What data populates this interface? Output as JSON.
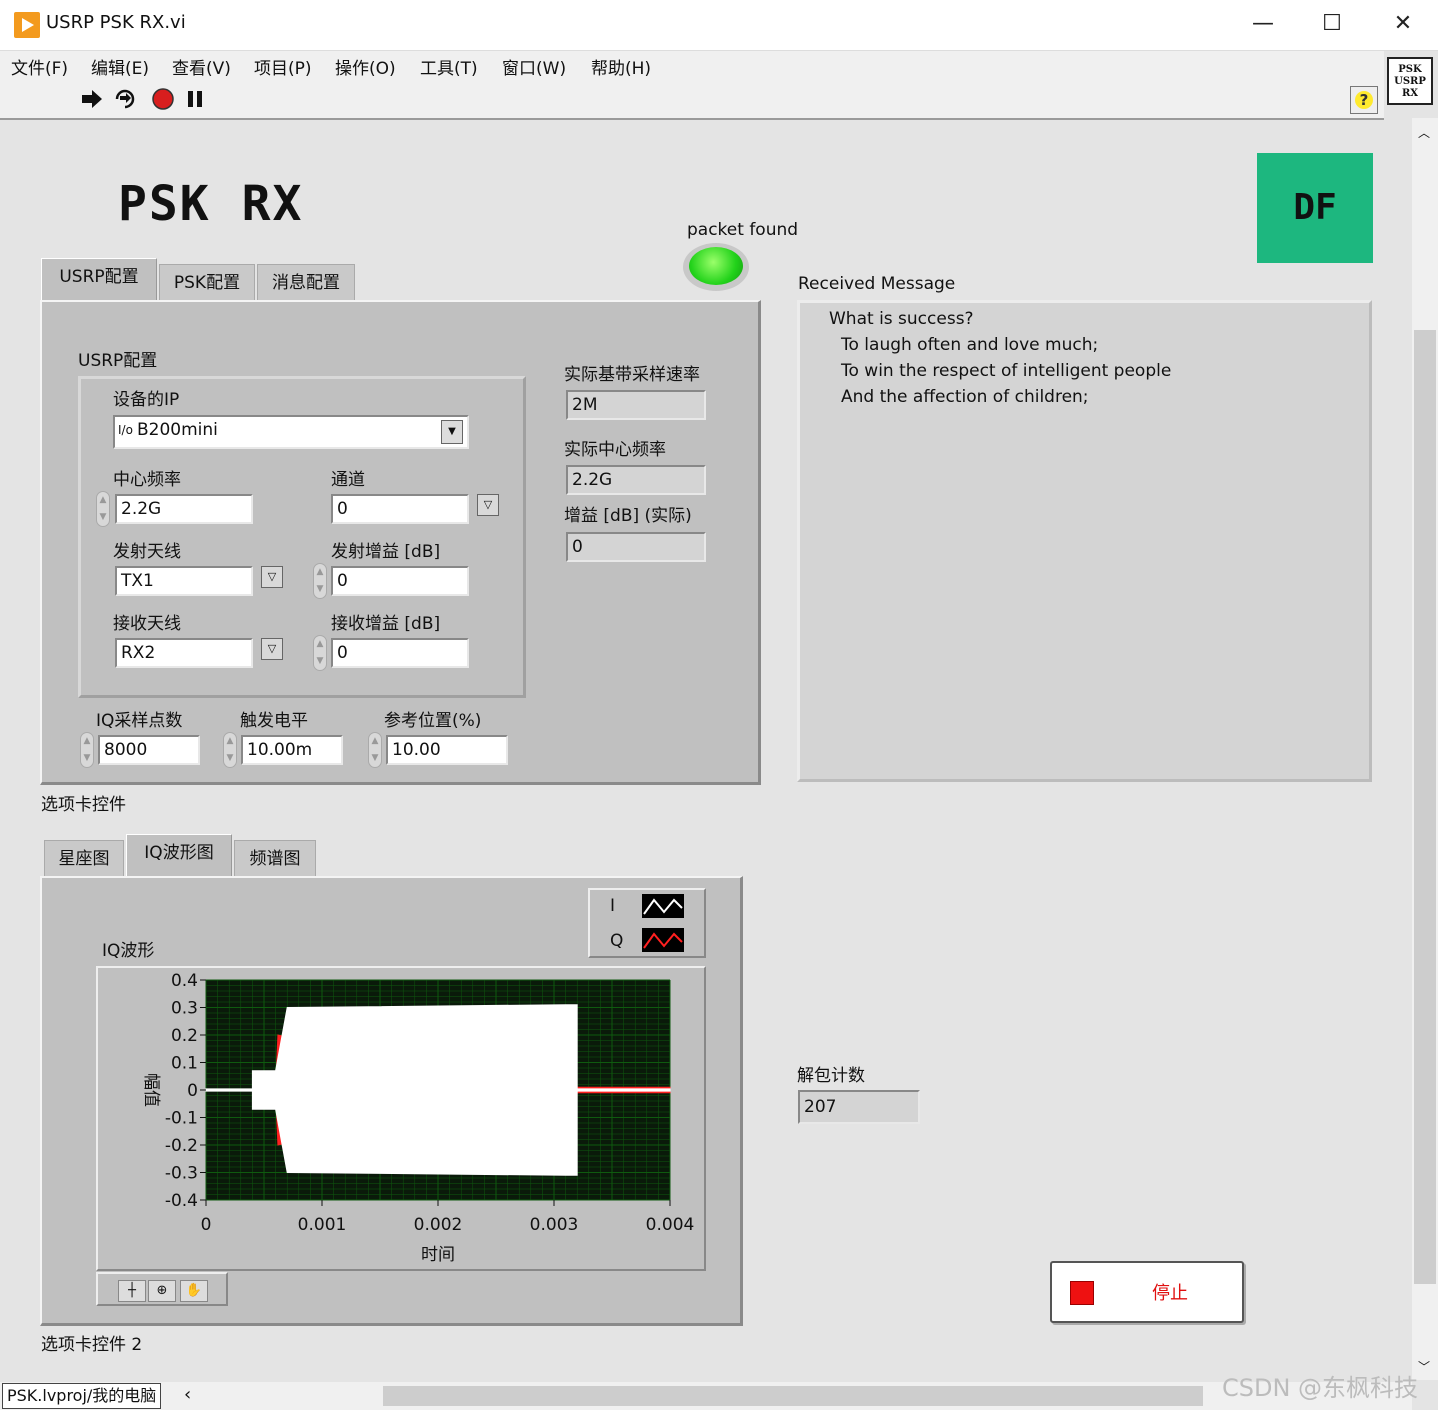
{
  "window": {
    "title": "USRP PSK RX.vi",
    "minimize": "—",
    "maximize": "☐",
    "close": "✕"
  },
  "menu": [
    "文件(F)",
    "编辑(E)",
    "查看(V)",
    "项目(P)",
    "操作(O)",
    "工具(T)",
    "窗口(W)",
    "帮助(H)"
  ],
  "toolbar": {
    "help": "?"
  },
  "conn_icon": {
    "line1": "PSK",
    "line2": "USRP",
    "line3": "RX"
  },
  "front_panel": {
    "title": "PSK  RX",
    "logo": "DF",
    "packet_found_label": "packet found",
    "packet_found_on": true,
    "tab1": {
      "tabs": [
        "USRP配置",
        "PSK配置",
        "消息配置"
      ],
      "active": 0,
      "caption": "选项卡控件",
      "group_label": "USRP配置",
      "device_ip_label": "设备的IP",
      "device_ip_value": "B200mini",
      "center_freq_label": "中心频率",
      "center_freq_value": "2.2G",
      "channel_label": "通道",
      "channel_value": "0",
      "tx_antenna_label": "发射天线",
      "tx_antenna_value": "TX1",
      "tx_gain_label": "发射增益 [dB]",
      "tx_gain_value": "0",
      "rx_antenna_label": "接收天线",
      "rx_antenna_value": "RX2",
      "rx_gain_label": "接收增益 [dB]",
      "rx_gain_value": "0",
      "iq_samples_label": "IQ采样点数",
      "iq_samples_value": "8000",
      "trigger_level_label": "触发电平",
      "trigger_level_value": "10.00m",
      "ref_pos_label": "参考位置(%)",
      "ref_pos_value": "10.00",
      "actual_rate_label": "实际基带采样速率",
      "actual_rate_value": "2M",
      "actual_freq_label": "实际中心频率",
      "actual_freq_value": "2.2G",
      "actual_gain_label": "增益 [dB] (实际)",
      "actual_gain_value": "0"
    },
    "received_message": {
      "label": "Received Message",
      "lines": [
        "What is success?",
        "To laugh often and love much;",
        "To win the respect of intelligent people",
        "And the affection of children;"
      ]
    },
    "tab2": {
      "tabs": [
        "星座图",
        "IQ波形图",
        "频谱图"
      ],
      "active": 1,
      "caption": "选项卡控件 2"
    },
    "packet_count_label": "解包计数",
    "packet_count_value": "207",
    "stop_label": "停止"
  },
  "chart_data": {
    "type": "line",
    "title": "IQ波形",
    "xlabel": "时间",
    "ylabel": "幅值",
    "xlim": [
      0,
      0.004
    ],
    "ylim": [
      -0.4,
      0.4
    ],
    "xticks": [
      "0",
      "0.001",
      "0.002",
      "0.003",
      "0.004"
    ],
    "yticks": [
      "0.4",
      "0.3",
      "0.2",
      "0.1",
      "0",
      "-0.1",
      "-0.2",
      "-0.3",
      "-0.4"
    ],
    "grid": true,
    "legend": "top-right",
    "background": "#0a1a0a",
    "grid_color": "#0f5a0f",
    "series": [
      {
        "name": "I",
        "color": "#ffffff",
        "envelope": [
          [
            0.0,
            0.004
          ],
          [
            0.0004,
            0.004
          ],
          [
            0.0004,
            0.07
          ],
          [
            0.0006,
            0.07
          ],
          [
            0.0007,
            0.3
          ],
          [
            0.0031,
            0.31
          ],
          [
            0.0032,
            0.31
          ],
          [
            0.0032,
            0.004
          ],
          [
            0.004,
            0.004
          ]
        ]
      },
      {
        "name": "Q",
        "color": "#ff2020",
        "envelope": [
          [
            0.0,
            0.002
          ],
          [
            0.0006,
            0.002
          ],
          [
            0.00062,
            0.2
          ],
          [
            0.0014,
            0.12
          ],
          [
            0.0015,
            0.26
          ],
          [
            0.0031,
            0.28
          ],
          [
            0.0032,
            0.01
          ],
          [
            0.004,
            0.01
          ]
        ]
      }
    ]
  },
  "status": {
    "project": "PSK.lvproj/我的电脑",
    "watermark": "CSDN @东枫科技"
  }
}
